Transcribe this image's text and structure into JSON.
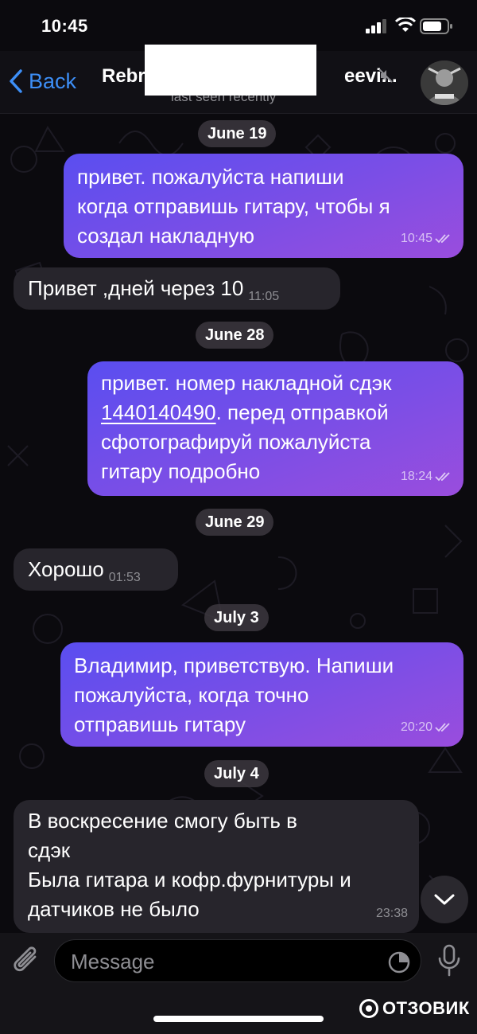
{
  "status_bar": {
    "time": "10:45"
  },
  "header": {
    "back_label": "Back",
    "title_start": "Rebr",
    "title_end": "eevi...",
    "subtitle": "last seen recently"
  },
  "messages": [
    {
      "type": "date",
      "text": "June 19"
    },
    {
      "type": "out",
      "lines": [
        "привет. пожалуйста напиши",
        "когда отправишь гитару, чтобы я",
        "создал накладную"
      ],
      "time": "10:45"
    },
    {
      "type": "in",
      "lines": [
        "Привет ,дней через 10"
      ],
      "time": "11:05"
    },
    {
      "type": "date",
      "text": "June 28"
    },
    {
      "type": "out",
      "lines": [
        "привет. номер накладной сдэк",
        "1440140490",
        ". перед отправкой",
        "сфотографируй пожалуйста",
        "гитару подробно"
      ],
      "time": "18:24"
    },
    {
      "type": "date",
      "text": "June 29"
    },
    {
      "type": "in",
      "lines": [
        "Хорошо"
      ],
      "time": "01:53"
    },
    {
      "type": "date",
      "text": "July 3"
    },
    {
      "type": "out",
      "lines": [
        "Владимир, приветствую. Напиши",
        "пожалуйста, когда точно",
        "отправишь гитару"
      ],
      "time": "20:20"
    },
    {
      "type": "date",
      "text": "July 4"
    },
    {
      "type": "in",
      "lines": [
        "В воскресение смогу быть в",
        "сдэк",
        "Была гитара и кофр.фурнитуры и",
        "датчиков не было"
      ],
      "time": "23:38"
    }
  ],
  "input": {
    "placeholder": "Message"
  },
  "watermark": "ОТЗОВИК",
  "icons": [
    "chevron-left-icon",
    "mute-icon",
    "attach-icon",
    "sticker-icon",
    "mic-icon",
    "chevron-down-icon",
    "signal-icon",
    "wifi-icon",
    "battery-icon"
  ],
  "colors": {
    "accent": "#3d8ff7",
    "outgoing_start": "#5a4ef0",
    "outgoing_end": "#9a4ddd",
    "incoming": "#27252c",
    "background": "#0b0a0e"
  }
}
